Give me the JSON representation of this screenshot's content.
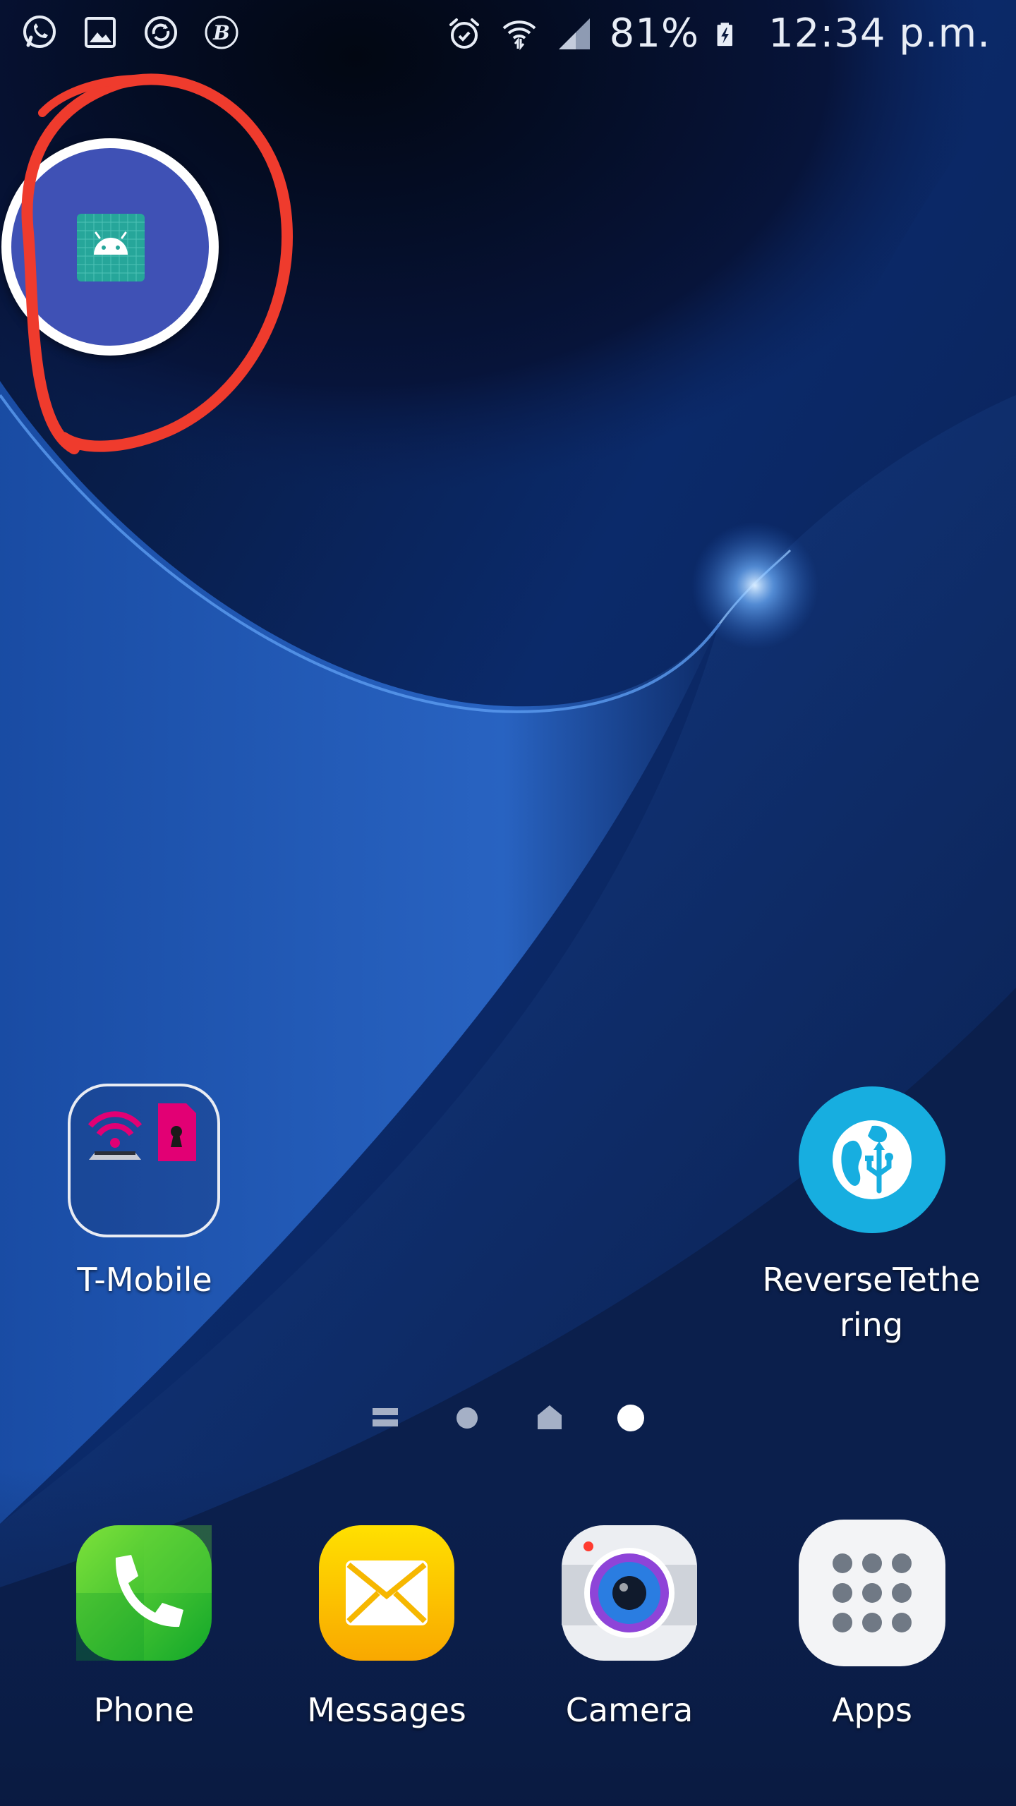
{
  "status_bar": {
    "notification_icons": [
      "whatsapp-icon",
      "gallery-icon",
      "sync-icon",
      "beta-icon"
    ],
    "system_icons": [
      "alarm-icon",
      "wifi-icon",
      "signal-icon",
      "battery-charging-icon"
    ],
    "battery": "81%",
    "time": "12:34 p.m."
  },
  "floating_bubble": {
    "icon": "android-app-icon",
    "accent": "#3f51b5",
    "annotation_color": "#ef3b2d"
  },
  "home_screen": {
    "folder": {
      "label": "T-Mobile",
      "icons": [
        "tmobile-wifi-icon",
        "tmobile-sim-icon"
      ]
    },
    "app": {
      "label": "ReverseTethe\nring",
      "icon": "reverse-tethering-icon",
      "color": "#17aee0"
    }
  },
  "page_indicator": {
    "items": [
      "menu-page",
      "page",
      "home-page",
      "page"
    ],
    "active_index": 3
  },
  "dock": {
    "apps": [
      {
        "label": "Phone",
        "icon": "phone-icon"
      },
      {
        "label": "Messages",
        "icon": "messages-icon"
      },
      {
        "label": "Camera",
        "icon": "camera-icon"
      },
      {
        "label": "Apps",
        "icon": "apps-grid-icon"
      }
    ]
  }
}
